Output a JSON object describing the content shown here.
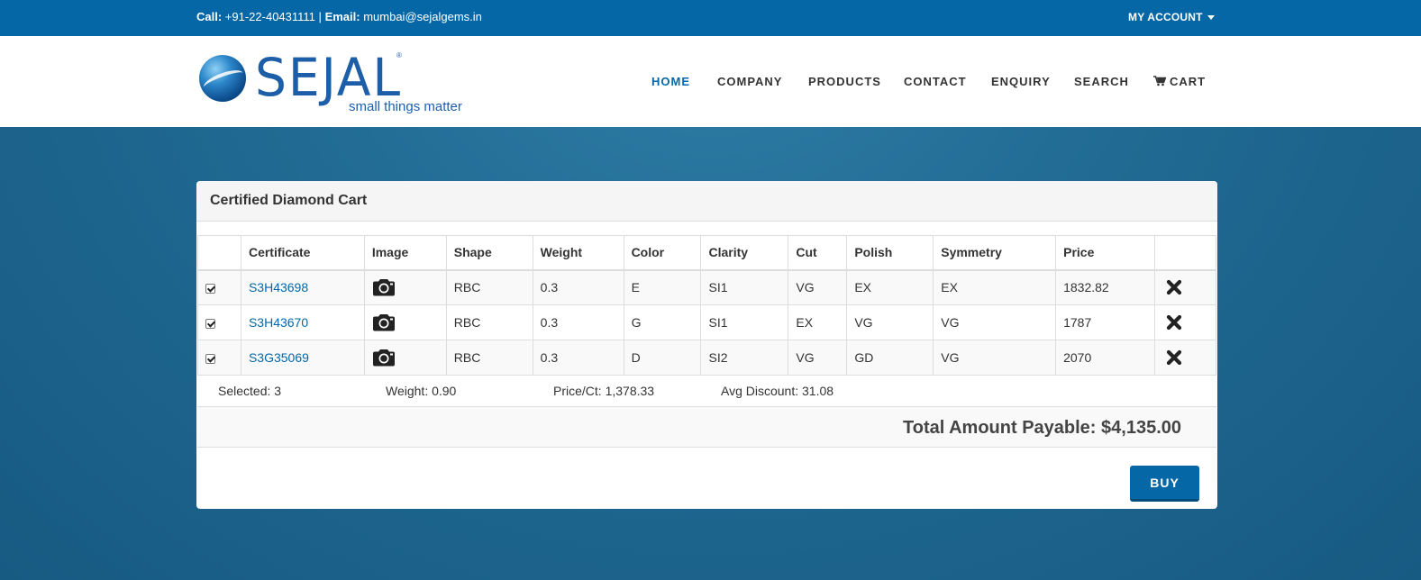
{
  "topbar": {
    "call_label": "Call:",
    "phone": "+91-22-40431111",
    "separator": "|",
    "email_label": "Email:",
    "email": "mumbai@sejalgems.in",
    "account": "MY ACCOUNT"
  },
  "logo": {
    "brand": "SEJAL",
    "registered": "®",
    "tagline": "small things matter"
  },
  "nav": [
    {
      "label": "HOME",
      "active": true
    },
    {
      "label": "COMPANY"
    },
    {
      "label": "PRODUCTS"
    },
    {
      "label": "CONTACT"
    },
    {
      "label": "ENQUIRY"
    },
    {
      "label": "SEARCH"
    },
    {
      "label": "CART",
      "icon": "shopping-cart-icon"
    }
  ],
  "panel": {
    "title": "Certified Diamond Cart"
  },
  "table": {
    "headers": [
      "",
      "Certificate",
      "Image",
      "Shape",
      "Weight",
      "Color",
      "Clarity",
      "Cut",
      "Polish",
      "Symmetry",
      "Price",
      ""
    ],
    "rows": [
      {
        "checked": true,
        "certificate": "S3H43698",
        "image_icon": "camera-icon",
        "shape": "RBC",
        "weight": "0.3",
        "color": "E",
        "clarity": "SI1",
        "cut": "VG",
        "polish": "EX",
        "symmetry": "EX",
        "price": "1832.82",
        "remove_icon": "remove-icon"
      },
      {
        "checked": true,
        "certificate": "S3H43670",
        "image_icon": "camera-icon",
        "shape": "RBC",
        "weight": "0.3",
        "color": "G",
        "clarity": "SI1",
        "cut": "EX",
        "polish": "VG",
        "symmetry": "VG",
        "price": "1787",
        "remove_icon": "remove-icon"
      },
      {
        "checked": true,
        "certificate": "S3G35069",
        "image_icon": "camera-icon",
        "shape": "RBC",
        "weight": "0.3",
        "color": "D",
        "clarity": "SI2",
        "cut": "VG",
        "polish": "GD",
        "symmetry": "VG",
        "price": "2070",
        "remove_icon": "remove-icon"
      }
    ]
  },
  "summary": {
    "selected": "Selected: 3",
    "weight": "Weight: 0.90",
    "price_ct": "Price/Ct: 1,378.33",
    "avg_discount": "Avg Discount: 31.08"
  },
  "total": "Total Amount Payable: $4,135.00",
  "buy_label": "BUY",
  "colors": {
    "brand_blue": "#0567a6",
    "background": "#206a93"
  }
}
